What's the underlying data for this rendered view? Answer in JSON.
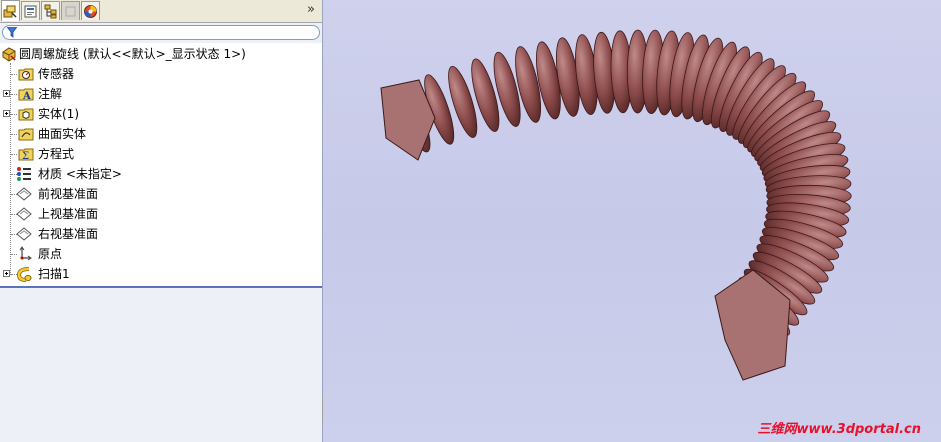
{
  "tabs": [
    {
      "name": "featuremanager-tab",
      "icon": "feature-tree-icon",
      "active": true
    },
    {
      "name": "propertymanager-tab",
      "icon": "property-manager-icon",
      "active": false
    },
    {
      "name": "configurationmanager-tab",
      "icon": "configuration-manager-icon",
      "active": false
    },
    {
      "name": "dimxpert-tab",
      "icon": "dimxpert-icon",
      "active": false,
      "disabled": true
    },
    {
      "name": "display-manager-tab",
      "icon": "appearance-ball-icon",
      "active": false
    }
  ],
  "panel": {
    "expand_symbol": "»"
  },
  "tree": {
    "root_label": "圆周螺旋线 (默认<<默认>_显示状态 1>)",
    "items": [
      {
        "label": "传感器",
        "icon": "sensor-icon",
        "expandable": false
      },
      {
        "label": "注解",
        "icon": "annotations-icon",
        "expandable": true
      },
      {
        "label": "实体(1)",
        "icon": "solid-bodies-icon",
        "expandable": true
      },
      {
        "label": "曲面实体",
        "icon": "surface-bodies-icon",
        "expandable": false
      },
      {
        "label": "方程式",
        "icon": "equations-icon",
        "expandable": false
      },
      {
        "label": "材质 <未指定>",
        "icon": "material-icon",
        "expandable": false
      },
      {
        "label": "前视基准面",
        "icon": "plane-icon",
        "expandable": false
      },
      {
        "label": "上视基准面",
        "icon": "plane-icon",
        "expandable": false
      },
      {
        "label": "右视基准面",
        "icon": "plane-icon",
        "expandable": false
      },
      {
        "label": "原点",
        "icon": "origin-icon",
        "expandable": false
      },
      {
        "label": "扫描1",
        "icon": "sweep-icon",
        "expandable": true
      }
    ]
  },
  "viewport": {
    "background": "#cacdeb",
    "model_color": "#8e4d4d",
    "watermark": "三维网www.3dportal.cn"
  },
  "colors": {
    "selection_border": "#5a74b8",
    "watermark": "#e8112d"
  }
}
